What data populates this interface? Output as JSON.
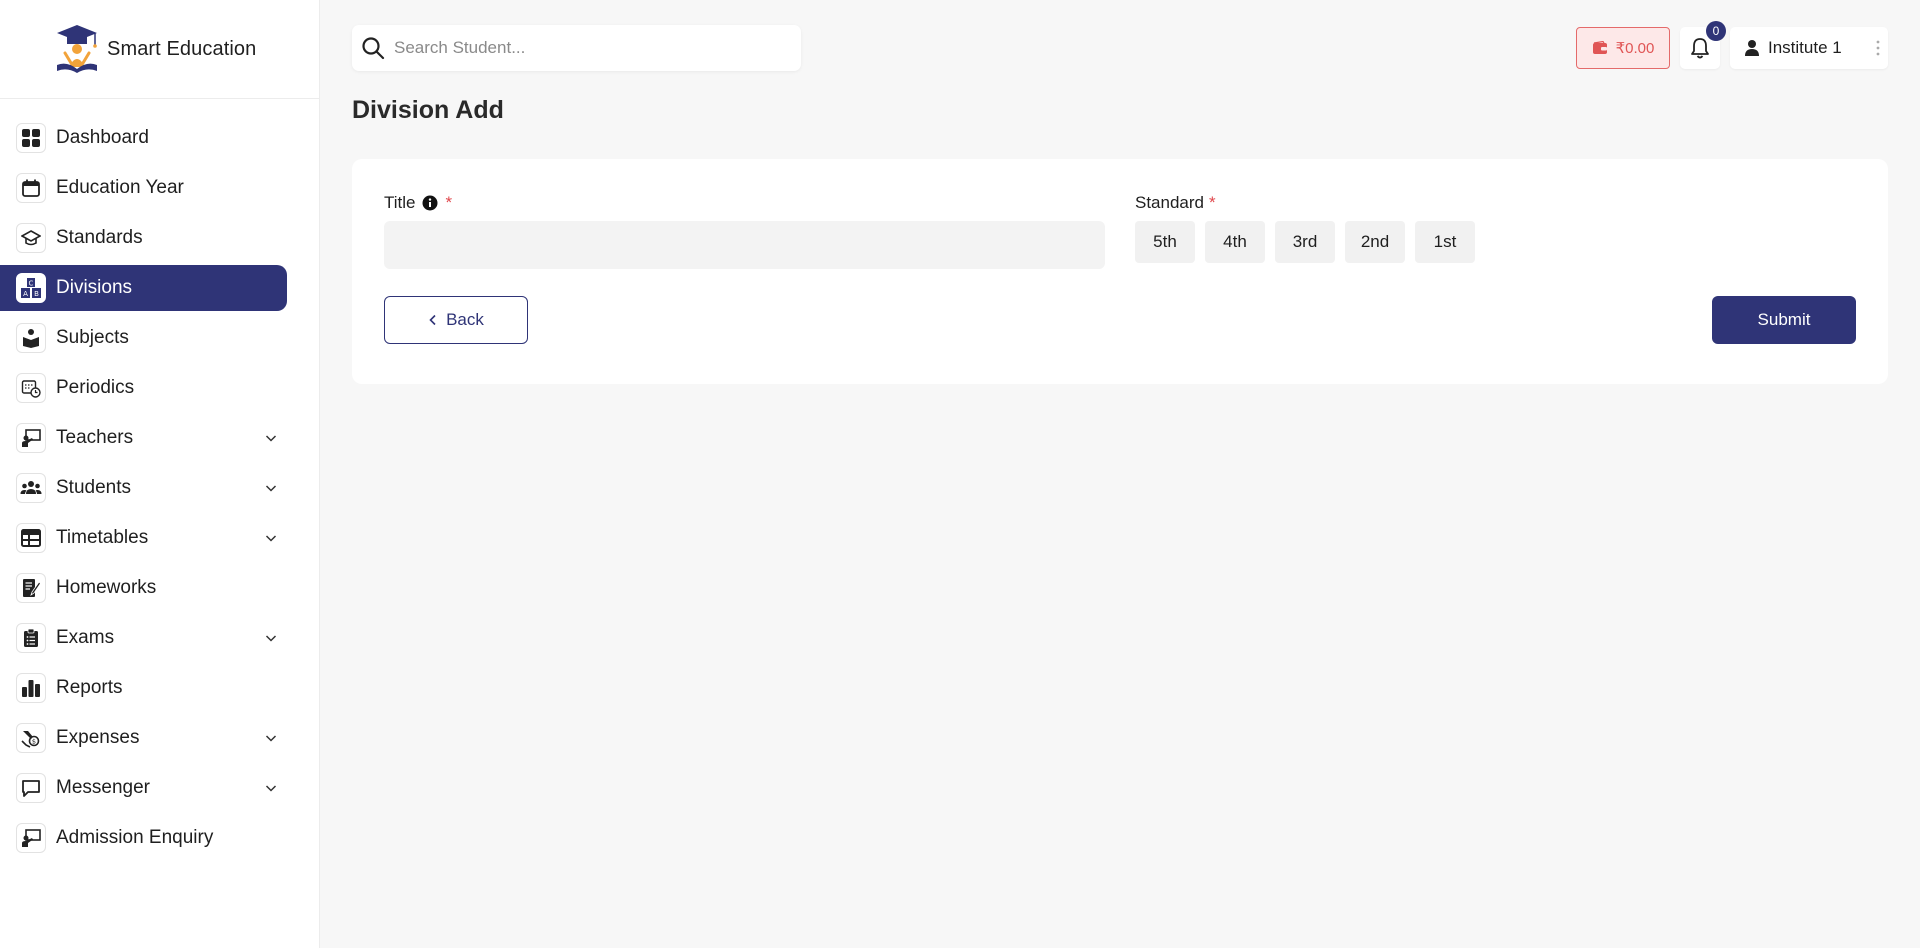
{
  "brand": {
    "name": "Smart Education",
    "logo_icon": "graduation-cap-logo"
  },
  "sidebar": {
    "items": [
      {
        "label": "Dashboard",
        "icon": "dashboard-grid-icon",
        "expandable": false,
        "active": false
      },
      {
        "label": "Education Year",
        "icon": "calendar-icon",
        "expandable": false,
        "active": false
      },
      {
        "label": "Standards",
        "icon": "mortarboard-icon",
        "expandable": false,
        "active": false
      },
      {
        "label": "Divisions",
        "icon": "abc-blocks-icon",
        "expandable": false,
        "active": true
      },
      {
        "label": "Subjects",
        "icon": "reading-person-icon",
        "expandable": false,
        "active": false
      },
      {
        "label": "Periodics",
        "icon": "calendar-clock-icon",
        "expandable": false,
        "active": false
      },
      {
        "label": "Teachers",
        "icon": "teacher-board-icon",
        "expandable": true,
        "active": false
      },
      {
        "label": "Students",
        "icon": "users-group-icon",
        "expandable": true,
        "active": false
      },
      {
        "label": "Timetables",
        "icon": "table-icon",
        "expandable": true,
        "active": false
      },
      {
        "label": "Homeworks",
        "icon": "notebook-pen-icon",
        "expandable": false,
        "active": false
      },
      {
        "label": "Exams",
        "icon": "clipboard-list-icon",
        "expandable": true,
        "active": false
      },
      {
        "label": "Reports",
        "icon": "bar-chart-icon",
        "expandable": false,
        "active": false
      },
      {
        "label": "Expenses",
        "icon": "hand-money-icon",
        "expandable": true,
        "active": false
      },
      {
        "label": "Messenger",
        "icon": "chat-bubble-icon",
        "expandable": true,
        "active": false
      },
      {
        "label": "Admission Enquiry",
        "icon": "teacher-board-icon",
        "expandable": false,
        "active": false
      }
    ]
  },
  "header": {
    "search_placeholder": "Search Student...",
    "wallet_amount": "₹0.00",
    "notification_count": "0",
    "user_name": "Institute 1"
  },
  "page": {
    "title": "Division Add"
  },
  "form": {
    "title_label": "Title",
    "title_value": "",
    "required_mark": "*",
    "standard_label": "Standard",
    "standards": [
      "5th",
      "4th",
      "3rd",
      "2nd",
      "1st"
    ],
    "back_label": "Back",
    "submit_label": "Submit"
  },
  "colors": {
    "primary": "#2f3477",
    "danger": "#e05555",
    "danger_bg": "#fde8e8",
    "required": "#e0474c"
  }
}
